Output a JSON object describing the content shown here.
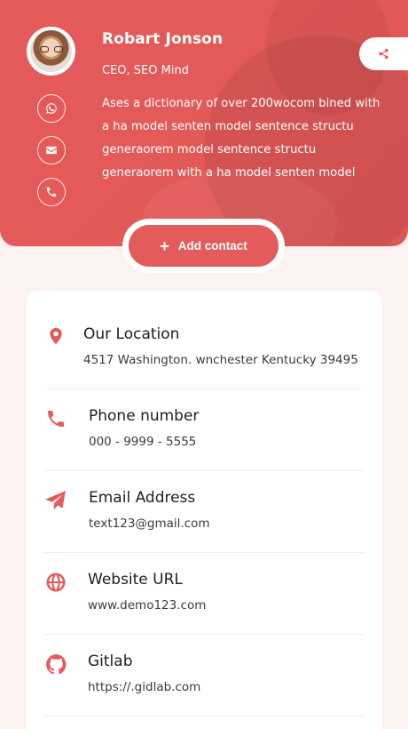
{
  "profile": {
    "name": "Robart Jonson",
    "role": "CEO, SEO Mind",
    "bio": "Ases a dictionary of over 200wocom bined with a ha model senten model sentence structu generaorem model sentence structu generaorem with a ha model senten model"
  },
  "actions": {
    "add_contact_label": "Add contact"
  },
  "side_icons": [
    "whatsapp-icon",
    "envelope-icon",
    "phone-icon"
  ],
  "info": [
    {
      "icon": "location-pin-icon",
      "title": "Our Location",
      "value": "4517 Washington. wnchester Kentucky 39495"
    },
    {
      "icon": "phone-icon",
      "title": "Phone number",
      "value": "000 - 9999 - 5555"
    },
    {
      "icon": "paper-plane-icon",
      "title": "Email Address",
      "value": "text123@gmail.com"
    },
    {
      "icon": "globe-icon",
      "title": "Website URL",
      "value": "www.demo123.com"
    },
    {
      "icon": "github-icon",
      "title": "Gitlab",
      "value": "https://.gidlab.com"
    }
  ],
  "colors": {
    "accent": "#e45b5b",
    "page_bg": "#fbf2f1",
    "card_bg": "#ffffff"
  }
}
